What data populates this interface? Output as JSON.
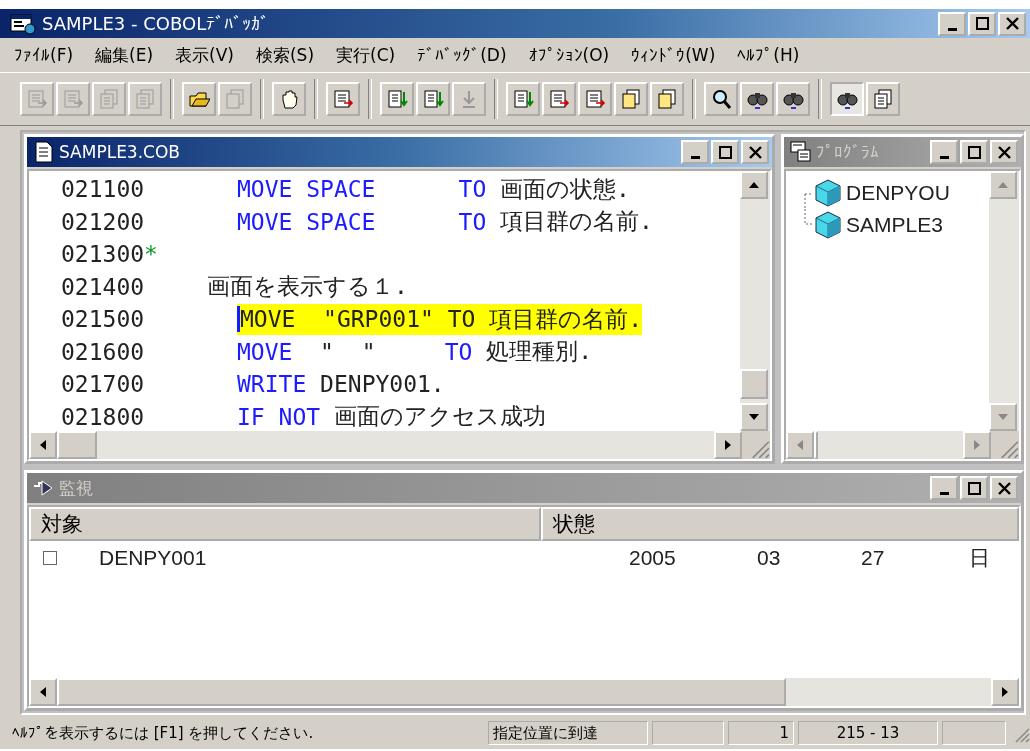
{
  "window": {
    "title": "SAMPLE3 - COBOLﾃﾞﾊﾞｯｶﾞ"
  },
  "menu": [
    "ﾌｧｲﾙ(F)",
    "編集(E)",
    "表示(V)",
    "検索(S)",
    "実行(C)",
    "ﾃﾞﾊﾞｯｸﾞ(D)",
    "ｵﾌﾟｼｮﾝ(O)",
    "ｳｨﾝﾄﾞｳ(W)",
    "ﾍﾙﾌﾟ(H)"
  ],
  "toolbar": [
    [
      {
        "disabled": true,
        "pressed": false
      },
      {
        "disabled": true,
        "pressed": false
      },
      {
        "disabled": true,
        "pressed": false
      },
      {
        "disabled": true,
        "pressed": false
      }
    ],
    [
      {
        "disabled": false,
        "pressed": false
      },
      {
        "disabled": true,
        "pressed": false
      }
    ],
    [
      {
        "disabled": false,
        "pressed": false
      }
    ],
    [
      {
        "disabled": false,
        "pressed": false
      }
    ],
    [
      {
        "disabled": false,
        "pressed": false
      },
      {
        "disabled": false,
        "pressed": false
      },
      {
        "disabled": true,
        "pressed": false
      }
    ],
    [
      {
        "disabled": false,
        "pressed": false
      },
      {
        "disabled": false,
        "pressed": false
      },
      {
        "disabled": false,
        "pressed": false
      },
      {
        "disabled": false,
        "pressed": false
      },
      {
        "disabled": false,
        "pressed": false
      }
    ],
    [
      {
        "disabled": false,
        "pressed": false
      },
      {
        "disabled": false,
        "pressed": false
      },
      {
        "disabled": false,
        "pressed": false
      }
    ],
    [
      {
        "disabled": false,
        "pressed": true
      },
      {
        "disabled": false,
        "pressed": false
      }
    ]
  ],
  "source_window": {
    "title": "SAMPLE3.COB",
    "active": true,
    "lines": [
      {
        "number": "021100",
        "kind": "statement",
        "current": false,
        "segments": [
          {
            "text": "MOVE SPACE",
            "kind": "keyword"
          },
          {
            "text": "      TO",
            "kind": "keyword"
          },
          {
            "text": " 画面の状態.",
            "kind": "plain"
          }
        ]
      },
      {
        "number": "021200",
        "kind": "statement",
        "current": false,
        "segments": [
          {
            "text": "MOVE SPACE",
            "kind": "keyword"
          },
          {
            "text": "      TO",
            "kind": "keyword"
          },
          {
            "text": " 項目群の名前.",
            "kind": "plain"
          }
        ]
      },
      {
        "number": "021300",
        "kind": "comment",
        "current": false,
        "segments": [
          {
            "text": "*",
            "kind": "comment"
          }
        ]
      },
      {
        "number": "021400",
        "kind": "paragraph",
        "current": false,
        "segments": [
          {
            "text": "画面を表示する１.",
            "kind": "plain"
          }
        ]
      },
      {
        "number": "021500",
        "kind": "statement",
        "current": true,
        "segments": [
          {
            "text": "MOVE  \"GRP001\" TO 項目群の名前.",
            "kind": "plain"
          }
        ]
      },
      {
        "number": "021600",
        "kind": "statement",
        "current": false,
        "segments": [
          {
            "text": "MOVE",
            "kind": "keyword"
          },
          {
            "text": "  \"  \"",
            "kind": "plain"
          },
          {
            "text": "     TO",
            "kind": "keyword"
          },
          {
            "text": " 処理種別.",
            "kind": "plain"
          }
        ]
      },
      {
        "number": "021700",
        "kind": "statement",
        "current": false,
        "segments": [
          {
            "text": "WRITE",
            "kind": "keyword"
          },
          {
            "text": " DENPY001.",
            "kind": "plain"
          }
        ]
      },
      {
        "number": "021800",
        "kind": "statement",
        "current": false,
        "segments": [
          {
            "text": "IF NOT",
            "kind": "keyword"
          },
          {
            "text": " 画面のアクセス成功",
            "kind": "plain"
          }
        ]
      }
    ]
  },
  "program_window": {
    "title": "ﾌﾟﾛｸﾞﾗﾑ",
    "active": false,
    "items": [
      "DENPYOU",
      "SAMPLE3"
    ]
  },
  "watch_window": {
    "title": "監視",
    "active": false,
    "columns": [
      "対象",
      "状態"
    ],
    "rows": [
      {
        "checked": false,
        "target": "DENPY001",
        "values": [
          "2005",
          "03",
          "27",
          "日"
        ]
      }
    ]
  },
  "status_bar": [
    {
      "kind": "text",
      "text": "ﾍﾙﾌﾟを表示するには [F1] を押してください."
    },
    {
      "kind": "text",
      "text": "指定位置に到達"
    },
    {
      "kind": "blank"
    },
    {
      "kind": "text",
      "text": "1"
    },
    {
      "kind": "text",
      "text": "215 - 13"
    },
    {
      "kind": "blank"
    }
  ]
}
